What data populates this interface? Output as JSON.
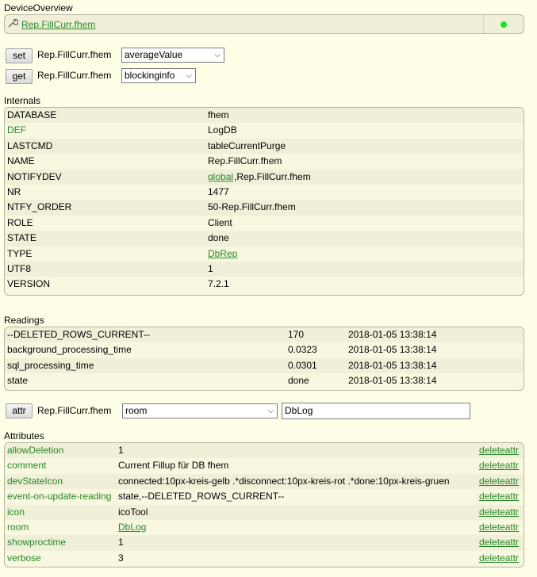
{
  "device_overview": {
    "title": "DeviceOverview",
    "device_name": "Rep.FillCurr.fhem",
    "icon": "wrench-icon",
    "status_color": "#19e619"
  },
  "commands": {
    "set": {
      "button": "set",
      "device": "Rep.FillCurr.fhem",
      "selected": "averageValue"
    },
    "get": {
      "button": "get",
      "device": "Rep.FillCurr.fhem",
      "selected": "blockinginfo"
    }
  },
  "internals": {
    "title": "Internals",
    "rows": [
      {
        "name": "DATABASE",
        "value": "fhem",
        "value2": ""
      },
      {
        "name": "DEF",
        "value": "LogDB",
        "value2": ""
      },
      {
        "name": "LASTCMD",
        "value": "tableCurrentPurge",
        "value2": ""
      },
      {
        "name": "NAME",
        "value": "Rep.FillCurr.fhem",
        "value2": ""
      },
      {
        "name": "NOTIFYDEV",
        "value": "global",
        "value2": ",Rep.FillCurr.fhem"
      },
      {
        "name": "NR",
        "value": "1477",
        "value2": ""
      },
      {
        "name": "NTFY_ORDER",
        "value": "50-Rep.FillCurr.fhem",
        "value2": ""
      },
      {
        "name": "ROLE",
        "value": "Client",
        "value2": ""
      },
      {
        "name": "STATE",
        "value": "done",
        "value2": ""
      },
      {
        "name": "TYPE",
        "value": "DbRep",
        "value2": ""
      },
      {
        "name": "UTF8",
        "value": "1",
        "value2": ""
      },
      {
        "name": "VERSION",
        "value": "7.2.1",
        "value2": ""
      }
    ]
  },
  "readings": {
    "title": "Readings",
    "rows": [
      {
        "name": "--DELETED_ROWS_CURRENT--",
        "value": "170",
        "time": "2018-01-05 13:38:14"
      },
      {
        "name": "background_processing_time",
        "value": "0.0323",
        "time": "2018-01-05 13:38:14"
      },
      {
        "name": "sql_processing_time",
        "value": "0.0301",
        "time": "2018-01-05 13:38:14"
      },
      {
        "name": "state",
        "value": "done",
        "time": "2018-01-05 13:38:14"
      }
    ]
  },
  "attr_command": {
    "button": "attr",
    "device": "Rep.FillCurr.fhem",
    "selected": "room",
    "value": "DbLog"
  },
  "attributes": {
    "title": "Attributes",
    "delete_label": "deleteattr",
    "rows": [
      {
        "name": "allowDeletion",
        "value": "1"
      },
      {
        "name": "comment",
        "value": "Current Fillup für DB fhem"
      },
      {
        "name": "devStateIcon",
        "value": "connected:10px-kreis-gelb .*disconnect:10px-kreis-rot .*done:10px-kreis-gruen"
      },
      {
        "name": "event-on-update-reading",
        "value": "state,--DELETED_ROWS_CURRENT--"
      },
      {
        "name": "icon",
        "value": "icoTool"
      },
      {
        "name": "room",
        "value": "DbLog"
      },
      {
        "name": "showproctime",
        "value": "1"
      },
      {
        "name": "verbose",
        "value": "3"
      }
    ]
  }
}
